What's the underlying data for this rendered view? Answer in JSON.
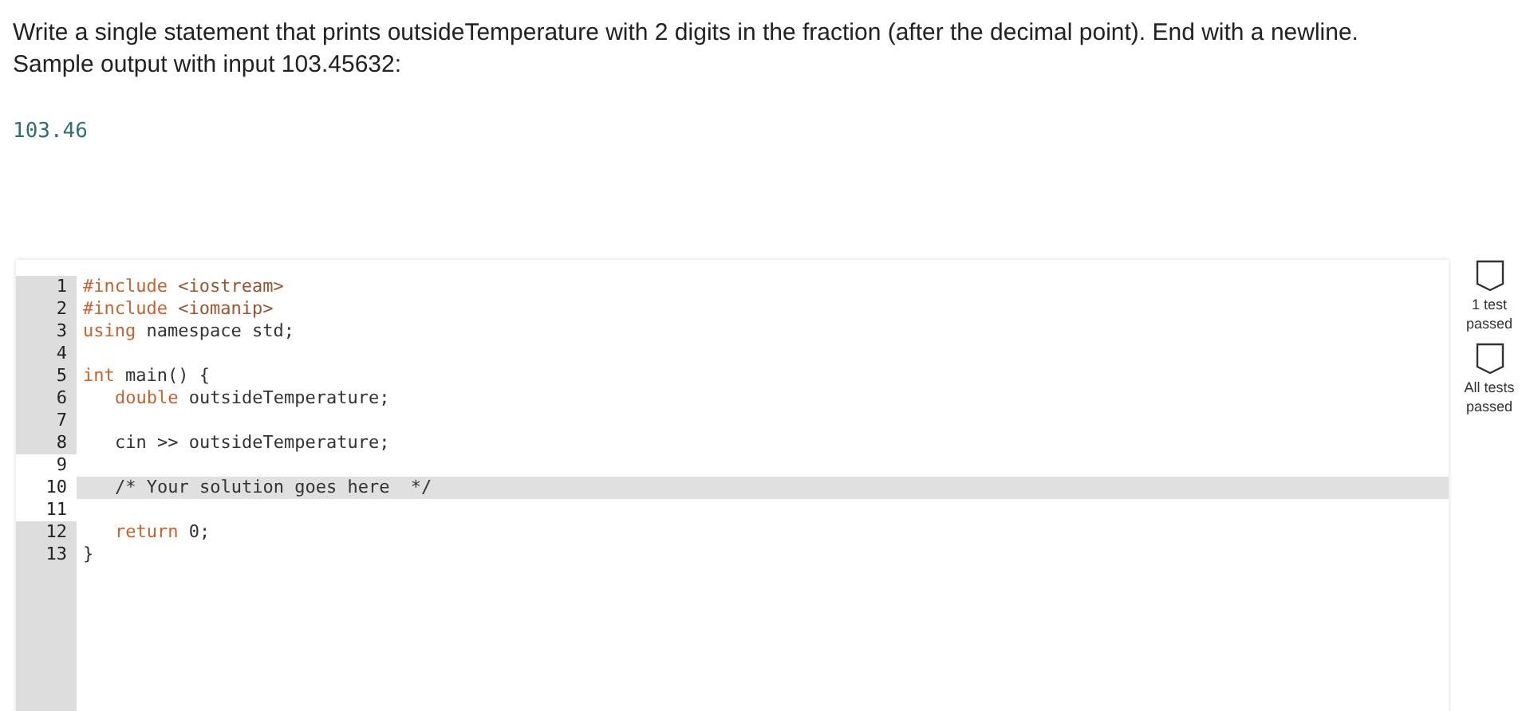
{
  "prompt": {
    "lines": [
      "Write a single statement that prints outsideTemperature with 2 digits in the fraction (after the decimal point). End with a newline.",
      "Sample output with input 103.45632:"
    ]
  },
  "sample_output": "103.46",
  "editor": {
    "lines": [
      {
        "number": "1",
        "active": false,
        "editable": false,
        "indent": false,
        "tokens": [
          {
            "kind": "keyword",
            "text": "#include"
          },
          {
            "kind": "string",
            "text": " <iostream>"
          }
        ]
      },
      {
        "number": "2",
        "active": false,
        "editable": false,
        "indent": false,
        "tokens": [
          {
            "kind": "keyword",
            "text": "#include"
          },
          {
            "kind": "string",
            "text": " <iomanip>"
          }
        ]
      },
      {
        "number": "3",
        "active": false,
        "editable": false,
        "indent": false,
        "tokens": [
          {
            "kind": "keyword",
            "text": "using"
          },
          {
            "kind": "plain",
            "text": " namespace std;"
          }
        ]
      },
      {
        "number": "4",
        "active": false,
        "editable": false
      },
      {
        "number": "5",
        "active": false,
        "editable": false,
        "indent": false,
        "tokens": [
          {
            "kind": "keyword",
            "text": "int"
          },
          {
            "kind": "plain",
            "text": " main() {"
          }
        ]
      },
      {
        "number": "6",
        "active": false,
        "editable": false,
        "indent": true,
        "tokens": [
          {
            "kind": "keyword",
            "text": "double"
          },
          {
            "kind": "plain",
            "text": " outsideTemperature;"
          }
        ]
      },
      {
        "number": "7",
        "active": false,
        "editable": false
      },
      {
        "number": "8",
        "active": false,
        "editable": false,
        "indent": true,
        "tokens": [
          {
            "kind": "plain",
            "text": "cin >> outsideTemperature;"
          }
        ]
      },
      {
        "number": "9",
        "active": false,
        "editable": true
      },
      {
        "number": "10",
        "active": true,
        "editable": true,
        "indent": true,
        "tokens": [
          {
            "kind": "plain",
            "text": "/* Your solution goes here  */"
          }
        ]
      },
      {
        "number": "11",
        "active": false,
        "editable": true
      },
      {
        "number": "12",
        "active": false,
        "editable": false,
        "indent": true,
        "tokens": [
          {
            "kind": "keyword",
            "text": "return"
          },
          {
            "kind": "plain",
            "text": " 0;"
          }
        ]
      },
      {
        "number": "13",
        "active": false,
        "editable": false,
        "indent": false,
        "tokens": [
          {
            "kind": "plain",
            "text": "}"
          }
        ]
      }
    ]
  },
  "tests": [
    {
      "label": "1 test passed"
    },
    {
      "label": "All tests passed"
    }
  ]
}
